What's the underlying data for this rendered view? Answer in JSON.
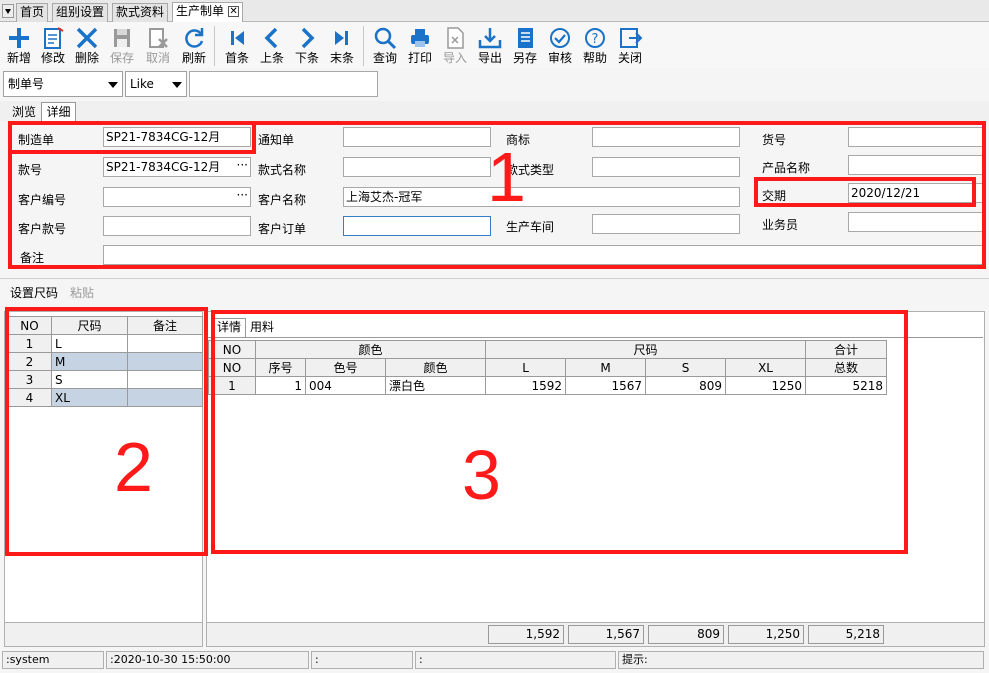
{
  "tabs": {
    "home": "首页",
    "group_settings": "组别设置",
    "style_data": "款式资料",
    "production_order": "生产制单"
  },
  "toolbar": {
    "new": "新增",
    "edit": "修改",
    "delete": "删除",
    "save": "保存",
    "cancel": "取消",
    "refresh": "刷新",
    "first": "首条",
    "prev": "上条",
    "next": "下条",
    "last": "末条",
    "query": "查询",
    "print": "打印",
    "import": "导入",
    "export": "导出",
    "save_as": "另存",
    "audit": "审核",
    "help": "帮助",
    "close": "关闭"
  },
  "search": {
    "field": "制单号",
    "operator": "Like",
    "value": ""
  },
  "view_tabs": {
    "browse": "浏览",
    "detail": "详细"
  },
  "form": {
    "order_no_label": "制造单",
    "order_no": "SP21-7834CG-12月",
    "notice_label": "通知单",
    "notice": "",
    "brand_label": "商标",
    "brand": "",
    "item_no_label": "货号",
    "item_no": "",
    "style_no_label": "款号",
    "style_no": "SP21-7834CG-12月",
    "style_name_label": "款式名称",
    "style_name": "",
    "style_type_label": "款式类型",
    "style_type": "",
    "product_name_label": "产品名称",
    "product_name": "",
    "customer_code_label": "客户编号",
    "customer_code": "",
    "customer_name_label": "客户名称",
    "customer_name": "上海艾杰-冠军",
    "delivery_label": "交期",
    "delivery": "2020/12/21",
    "customer_style_label": "客户款号",
    "customer_style": "",
    "customer_order_label": "客户订单",
    "customer_order": "",
    "workshop_label": "生产车间",
    "workshop": "",
    "salesman_label": "业务员",
    "salesman": "",
    "remark_label": "备注",
    "remark": ""
  },
  "actions": {
    "set_size": "设置尺码",
    "paste": "粘贴"
  },
  "size_table": {
    "headers": [
      "NO",
      "尺码",
      "备注"
    ],
    "rows": [
      {
        "no": "1",
        "size": "L",
        "note": ""
      },
      {
        "no": "2",
        "size": "M",
        "note": ""
      },
      {
        "no": "3",
        "size": "S",
        "note": ""
      },
      {
        "no": "4",
        "size": "XL",
        "note": ""
      }
    ]
  },
  "detail_tabs": {
    "detail": "详情",
    "material": "用料"
  },
  "detail_table": {
    "group_no": "NO",
    "group_color": "颜色",
    "group_size": "尺码",
    "group_total": "合计",
    "sub_headers": [
      "NO",
      "序号",
      "色号",
      "颜色",
      "L",
      "M",
      "S",
      "XL",
      "总数"
    ],
    "rows": [
      {
        "no": "1",
        "seq": "1",
        "color_code": "004",
        "color": "漂白色",
        "L": "1592",
        "M": "1567",
        "S": "809",
        "XL": "1250",
        "total": "5218"
      }
    ],
    "totals": {
      "L": "1,592",
      "M": "1,567",
      "S": "809",
      "XL": "1,250",
      "total": "5,218"
    }
  },
  "annotations": {
    "n1": "1",
    "n2": "2",
    "n3": "3"
  },
  "status": {
    "user": ":system",
    "time": ":2020-10-30 15:50:00",
    "s3": ":",
    "s4": ":",
    "hint": "提示:"
  },
  "colors": {
    "highlight_red": "#ff1a1a",
    "icon_blue": "#1a73c8",
    "selected_row": "#c5d3e3"
  }
}
